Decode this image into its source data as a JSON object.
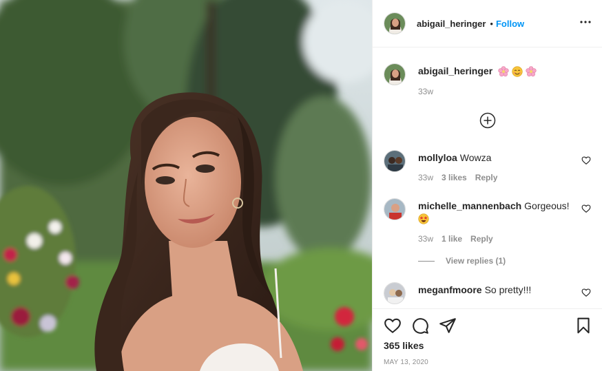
{
  "post": {
    "author": "abigail_heringer",
    "separator": "•",
    "follow_label": "Follow",
    "more_icon": "more-options-icon",
    "caption": {
      "username": "abigail_heringer",
      "emojis": [
        "cherry-blossom-emoji",
        "smiling-face-emoji",
        "cherry-blossom-emoji"
      ],
      "time": "33w"
    },
    "load_more_icon": "plus-circle-icon"
  },
  "comments": [
    {
      "username": "mollyloa",
      "text": "Wowza",
      "time": "33w",
      "likes": "3 likes",
      "reply_label": "Reply"
    },
    {
      "username": "michelle_mannenbach",
      "text": "Gorgeous!",
      "emoji": "star-struck-emoji",
      "time": "33w",
      "likes": "1 like",
      "reply_label": "Reply",
      "view_replies": "View replies (1)"
    },
    {
      "username": "meganfmoore",
      "text": "So pretty!!!"
    }
  ],
  "actions": {
    "like_icon": "heart-icon",
    "comment_icon": "comment-icon",
    "share_icon": "paper-plane-icon",
    "save_icon": "bookmark-icon",
    "likes_count": "365 likes",
    "date": "MAY 13, 2020"
  },
  "colors": {
    "link": "#0095f6",
    "muted": "#8e8e8e",
    "border": "#efefef",
    "text": "#262626"
  }
}
